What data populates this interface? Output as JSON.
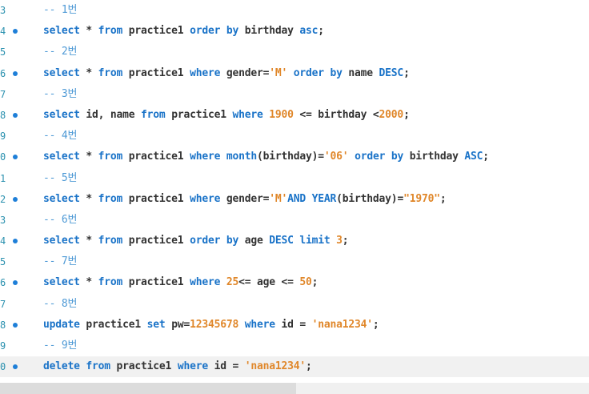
{
  "editor": {
    "lines": [
      {
        "num": "3",
        "marker": false,
        "tokens": [
          {
            "t": "-- 1번",
            "c": "cm"
          }
        ]
      },
      {
        "num": "4",
        "marker": true,
        "tokens": [
          {
            "t": "select",
            "c": "kw"
          },
          {
            "t": " * ",
            "c": "op"
          },
          {
            "t": "from",
            "c": "kw"
          },
          {
            "t": " practice1 ",
            "c": "id"
          },
          {
            "t": "order by",
            "c": "kw"
          },
          {
            "t": " birthday ",
            "c": "id"
          },
          {
            "t": "asc",
            "c": "kw"
          },
          {
            "t": ";",
            "c": "op"
          }
        ]
      },
      {
        "num": "5",
        "marker": false,
        "tokens": [
          {
            "t": "-- 2번",
            "c": "cm"
          }
        ]
      },
      {
        "num": "6",
        "marker": true,
        "tokens": [
          {
            "t": "select",
            "c": "kw"
          },
          {
            "t": " * ",
            "c": "op"
          },
          {
            "t": "from",
            "c": "kw"
          },
          {
            "t": " practice1 ",
            "c": "id"
          },
          {
            "t": "where",
            "c": "kw"
          },
          {
            "t": " gender=",
            "c": "id"
          },
          {
            "t": "'M'",
            "c": "str"
          },
          {
            "t": " ",
            "c": "op"
          },
          {
            "t": "order by",
            "c": "kw"
          },
          {
            "t": " name ",
            "c": "id"
          },
          {
            "t": "DESC",
            "c": "kw"
          },
          {
            "t": ";",
            "c": "op"
          }
        ]
      },
      {
        "num": "7",
        "marker": false,
        "tokens": [
          {
            "t": "-- 3번",
            "c": "cm"
          }
        ]
      },
      {
        "num": "8",
        "marker": true,
        "tokens": [
          {
            "t": "select",
            "c": "kw"
          },
          {
            "t": " id, name ",
            "c": "id"
          },
          {
            "t": "from",
            "c": "kw"
          },
          {
            "t": " practice1 ",
            "c": "id"
          },
          {
            "t": "where",
            "c": "kw"
          },
          {
            "t": " ",
            "c": "op"
          },
          {
            "t": "1900",
            "c": "num"
          },
          {
            "t": " <= birthday <",
            "c": "id"
          },
          {
            "t": "2000",
            "c": "num"
          },
          {
            "t": ";",
            "c": "op"
          }
        ]
      },
      {
        "num": "9",
        "marker": false,
        "tokens": [
          {
            "t": "-- 4번",
            "c": "cm"
          }
        ]
      },
      {
        "num": "0",
        "marker": true,
        "tokens": [
          {
            "t": "select",
            "c": "kw"
          },
          {
            "t": " * ",
            "c": "op"
          },
          {
            "t": "from",
            "c": "kw"
          },
          {
            "t": " practice1 ",
            "c": "id"
          },
          {
            "t": "where",
            "c": "kw"
          },
          {
            "t": " ",
            "c": "op"
          },
          {
            "t": "month",
            "c": "kw"
          },
          {
            "t": "(birthday)=",
            "c": "id"
          },
          {
            "t": "'06'",
            "c": "str"
          },
          {
            "t": " ",
            "c": "op"
          },
          {
            "t": "order by",
            "c": "kw"
          },
          {
            "t": " birthday ",
            "c": "id"
          },
          {
            "t": "ASC",
            "c": "kw"
          },
          {
            "t": ";",
            "c": "op"
          }
        ]
      },
      {
        "num": "1",
        "marker": false,
        "tokens": [
          {
            "t": "-- 5번",
            "c": "cm"
          }
        ]
      },
      {
        "num": "2",
        "marker": true,
        "tokens": [
          {
            "t": "select",
            "c": "kw"
          },
          {
            "t": " * ",
            "c": "op"
          },
          {
            "t": "from",
            "c": "kw"
          },
          {
            "t": " practice1 ",
            "c": "id"
          },
          {
            "t": "where",
            "c": "kw"
          },
          {
            "t": " gender=",
            "c": "id"
          },
          {
            "t": "'M'",
            "c": "str"
          },
          {
            "t": "AND",
            "c": "kw"
          },
          {
            "t": " ",
            "c": "op"
          },
          {
            "t": "YEAR",
            "c": "kw"
          },
          {
            "t": "(birthday)=",
            "c": "id"
          },
          {
            "t": "\"1970\"",
            "c": "str"
          },
          {
            "t": ";",
            "c": "op"
          }
        ]
      },
      {
        "num": "3",
        "marker": false,
        "tokens": [
          {
            "t": "-- 6번",
            "c": "cm"
          }
        ]
      },
      {
        "num": "4",
        "marker": true,
        "tokens": [
          {
            "t": "select",
            "c": "kw"
          },
          {
            "t": " * ",
            "c": "op"
          },
          {
            "t": "from",
            "c": "kw"
          },
          {
            "t": " practice1 ",
            "c": "id"
          },
          {
            "t": "order by",
            "c": "kw"
          },
          {
            "t": " age ",
            "c": "id"
          },
          {
            "t": "DESC limit",
            "c": "kw"
          },
          {
            "t": " ",
            "c": "op"
          },
          {
            "t": "3",
            "c": "num"
          },
          {
            "t": ";",
            "c": "op"
          }
        ]
      },
      {
        "num": "5",
        "marker": false,
        "tokens": [
          {
            "t": "-- 7번",
            "c": "cm"
          }
        ]
      },
      {
        "num": "6",
        "marker": true,
        "tokens": [
          {
            "t": "select",
            "c": "kw"
          },
          {
            "t": " * ",
            "c": "op"
          },
          {
            "t": "from",
            "c": "kw"
          },
          {
            "t": " practice1 ",
            "c": "id"
          },
          {
            "t": "where",
            "c": "kw"
          },
          {
            "t": " ",
            "c": "op"
          },
          {
            "t": "25",
            "c": "num"
          },
          {
            "t": "<= age <= ",
            "c": "id"
          },
          {
            "t": "50",
            "c": "num"
          },
          {
            "t": ";",
            "c": "op"
          }
        ]
      },
      {
        "num": "7",
        "marker": false,
        "tokens": [
          {
            "t": "-- 8번",
            "c": "cm"
          }
        ]
      },
      {
        "num": "8",
        "marker": true,
        "tokens": [
          {
            "t": "update",
            "c": "kw"
          },
          {
            "t": " practice1 ",
            "c": "id"
          },
          {
            "t": "set",
            "c": "kw"
          },
          {
            "t": " pw=",
            "c": "id"
          },
          {
            "t": "12345678",
            "c": "num"
          },
          {
            "t": " ",
            "c": "op"
          },
          {
            "t": "where",
            "c": "kw"
          },
          {
            "t": " id = ",
            "c": "id"
          },
          {
            "t": "'nana1234'",
            "c": "str"
          },
          {
            "t": ";",
            "c": "op"
          }
        ]
      },
      {
        "num": "9",
        "marker": false,
        "tokens": [
          {
            "t": "-- 9번",
            "c": "cm"
          }
        ]
      },
      {
        "num": "0",
        "marker": true,
        "current": true,
        "tokens": [
          {
            "t": "delete",
            "c": "kw"
          },
          {
            "t": " ",
            "c": "op"
          },
          {
            "t": "from",
            "c": "kw"
          },
          {
            "t": " practice1 ",
            "c": "id"
          },
          {
            "t": "where",
            "c": "kw"
          },
          {
            "t": " id = ",
            "c": "id"
          },
          {
            "t": "'nana1234'",
            "c": "str"
          },
          {
            "t": ";",
            "c": "op"
          }
        ]
      }
    ]
  },
  "colors": {
    "keyword": "#1a73c8",
    "identifier": "#333333",
    "literal": "#e0872a",
    "comment": "#4f9ad6",
    "line_number": "#2b91af",
    "marker": "#1e7fd8",
    "current_line": "#f1f1f1"
  },
  "icons": {
    "statement_marker": "execution-dot-icon"
  }
}
